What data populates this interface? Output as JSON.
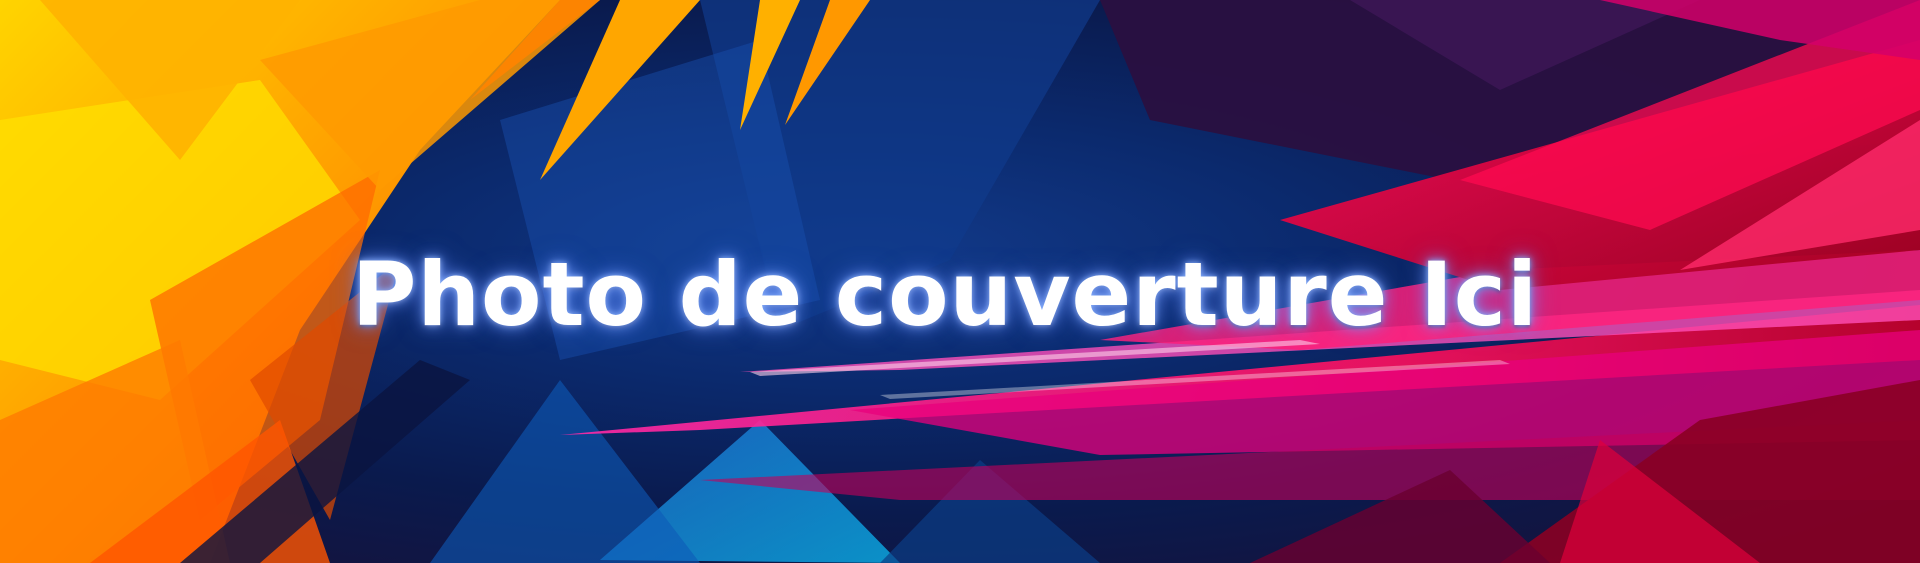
{
  "cover": {
    "title": "Photo de couverture Ici"
  },
  "palette": {
    "yellow": "#ffd400",
    "orange": "#ff8a00",
    "deep_blue": "#0b2a6e",
    "cyan": "#1fa3e0",
    "magenta": "#ff1a8c",
    "red": "#e0002a",
    "purple": "#3a1450"
  }
}
